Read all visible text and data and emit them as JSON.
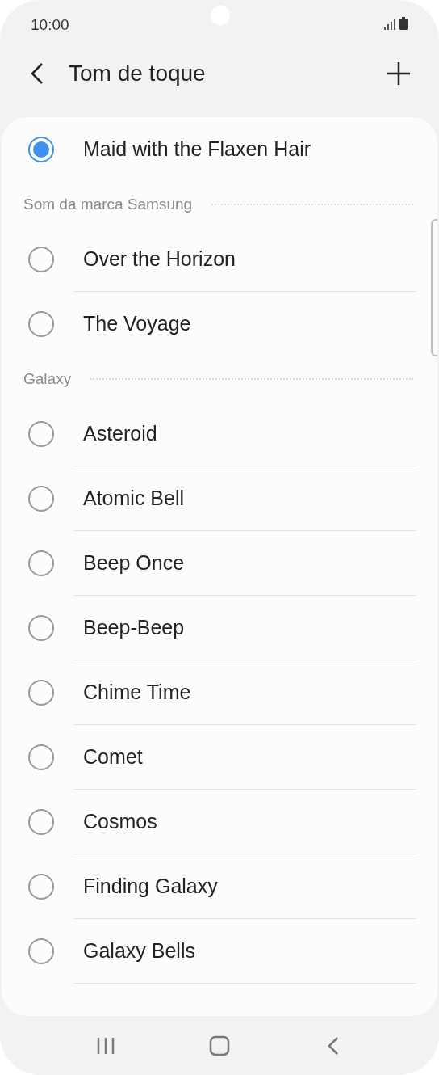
{
  "status_bar": {
    "time": "10:00"
  },
  "header": {
    "title": "Tom de toque"
  },
  "sections": [
    {
      "items": [
        {
          "label": "Maid with the Flaxen Hair",
          "selected": true
        }
      ]
    },
    {
      "heading": "Som da marca Samsung",
      "items": [
        {
          "label": "Over the Horizon",
          "selected": false
        },
        {
          "label": "The Voyage",
          "selected": false
        }
      ]
    },
    {
      "heading": "Galaxy",
      "items": [
        {
          "label": "Asteroid",
          "selected": false
        },
        {
          "label": "Atomic Bell",
          "selected": false
        },
        {
          "label": "Beep Once",
          "selected": false
        },
        {
          "label": "Beep-Beep",
          "selected": false
        },
        {
          "label": "Chime Time",
          "selected": false
        },
        {
          "label": "Comet",
          "selected": false
        },
        {
          "label": "Cosmos",
          "selected": false
        },
        {
          "label": "Finding Galaxy",
          "selected": false
        },
        {
          "label": "Galaxy Bells",
          "selected": false
        }
      ]
    }
  ]
}
